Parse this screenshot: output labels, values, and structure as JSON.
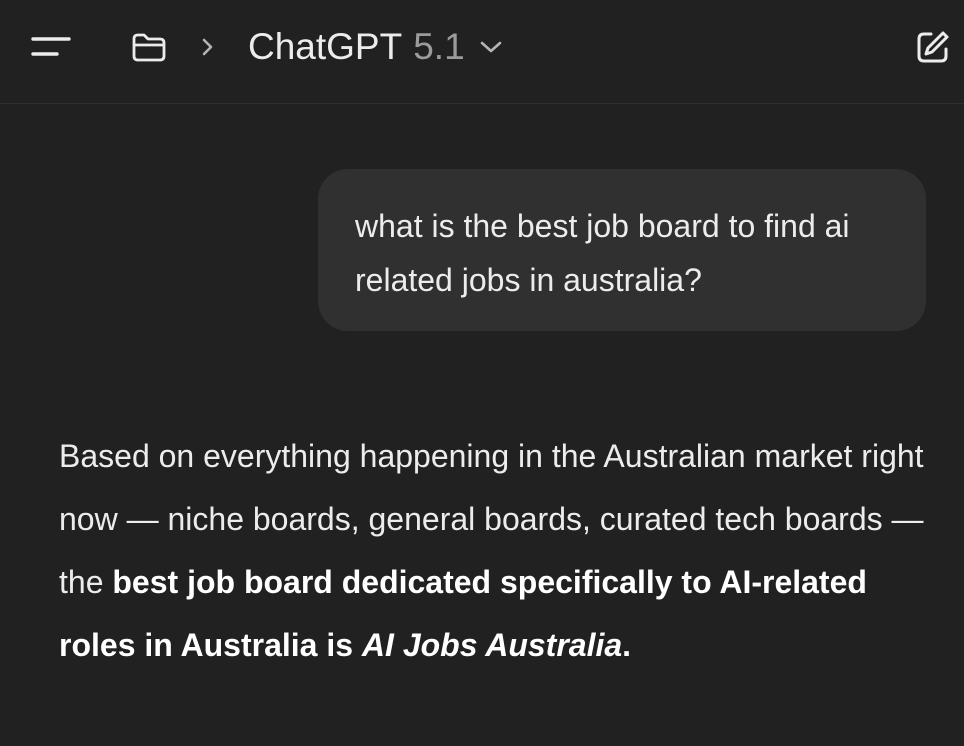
{
  "header": {
    "title": "ChatGPT",
    "version": "5.1",
    "icons": [
      "menu-icon",
      "folder-icon",
      "chevron-right-icon",
      "chevron-down-icon",
      "edit-icon"
    ]
  },
  "conversation": {
    "user_message": "what is the best job board to find ai related jobs in australia?",
    "assistant_message": {
      "intro": "Based on everything happening in the Australian market right now — niche boards, general boards, curated tech boards — the ",
      "bold": "best job board dedicated specifically to AI-related roles in Australia is ",
      "italic_bold": "AI Jobs Australia",
      "end": "."
    }
  },
  "colors": {
    "background": "#212121",
    "bubble": "#303030",
    "text": "#ececec",
    "muted": "#9b9b9b"
  }
}
